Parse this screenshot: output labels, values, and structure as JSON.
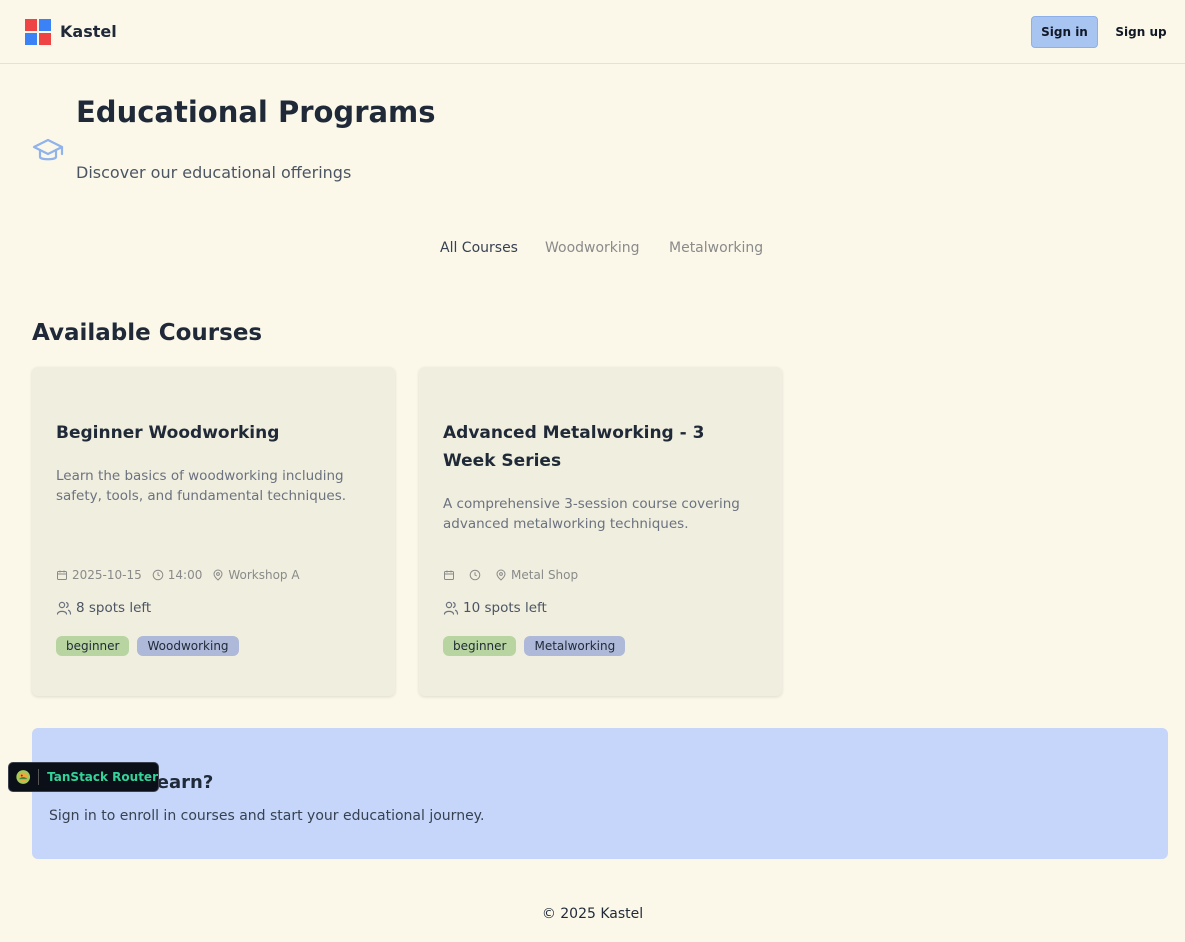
{
  "header": {
    "brand": "Kastel",
    "sign_in": "Sign in",
    "sign_up": "Sign up"
  },
  "hero": {
    "icon": "graduation-cap-icon",
    "title": "Educational Programs",
    "subtitle": "Discover our educational offerings"
  },
  "tabs": [
    {
      "label": "All Courses",
      "active": true
    },
    {
      "label": "Woodworking",
      "active": false
    },
    {
      "label": "Metalworking",
      "active": false
    }
  ],
  "section_title": "Available Courses",
  "courses": [
    {
      "title": "Beginner Woodworking",
      "description": "Learn the basics of woodworking including safety, tools, and fundamental techniques.",
      "date": "2025-10-15",
      "time": "14:00",
      "location": "Workshop A",
      "spots": "8 spots left",
      "level": "beginner",
      "category": "Woodworking"
    },
    {
      "title": "Advanced Metalworking - 3 Week Series",
      "description": "A comprehensive 3-session course covering advanced metalworking techniques.",
      "date": "",
      "time": "",
      "location": "Metal Shop",
      "spots": "10 spots left",
      "level": "beginner",
      "category": "Metalworking"
    }
  ],
  "cta": {
    "title": "Ready to Learn?",
    "text": "Sign in to enroll in courses and start your educational journey."
  },
  "devtools_badge": "TanStack Router",
  "footer": "© 2025 Kastel",
  "colors": {
    "background": "#fbf8ea",
    "card": "#f0eede",
    "cta": "#c5d6fa",
    "sign_in_button": "#a8c4f0",
    "tag_level": "#b8d4a0",
    "tag_category": "#aeb8d8"
  }
}
